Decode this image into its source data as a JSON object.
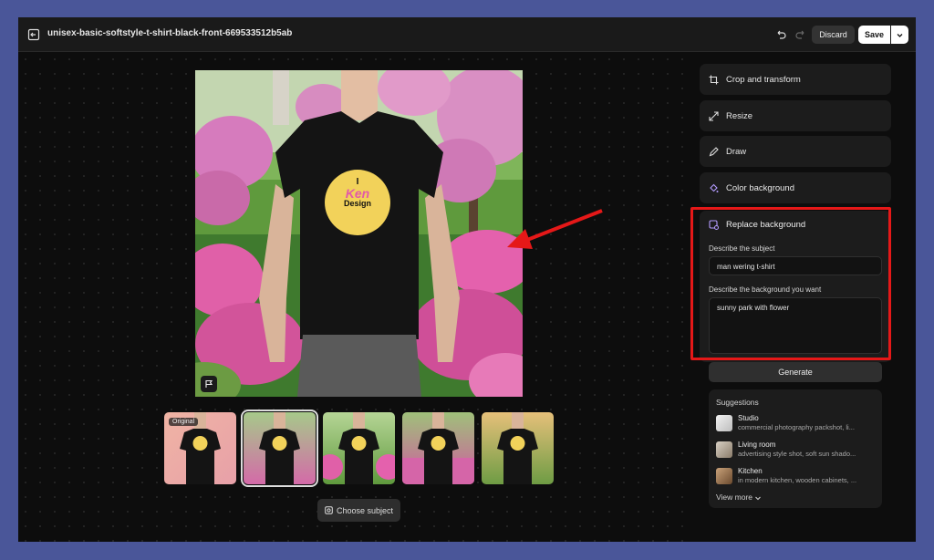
{
  "topbar": {
    "file_title": "unisex-basic-softstyle-t-shirt-black-front-669533512b5ab",
    "discard_label": "Discard",
    "save_label": "Save"
  },
  "canvas": {
    "thumbnails": [
      {
        "label": "Original",
        "selected": false
      },
      {
        "label": "",
        "selected": true
      },
      {
        "label": "",
        "selected": false
      },
      {
        "label": "",
        "selected": false
      },
      {
        "label": "",
        "selected": false
      }
    ],
    "choose_subject_label": "Choose subject",
    "tshirt_print": {
      "line1": "I",
      "line2": "Ken",
      "line3": "Design"
    }
  },
  "panel": {
    "items": [
      {
        "label": "Crop and transform",
        "icon": "crop-icon"
      },
      {
        "label": "Resize",
        "icon": "resize-icon"
      },
      {
        "label": "Draw",
        "icon": "draw-icon"
      },
      {
        "label": "Color background",
        "icon": "color-background-icon"
      }
    ],
    "replace_background": {
      "title": "Replace background",
      "subject_label": "Describe the subject",
      "subject_value": "man wering t-shirt",
      "background_label": "Describe the background you want",
      "background_value": "sunny park with flower"
    },
    "generate_label": "Generate",
    "suggestions": {
      "title": "Suggestions",
      "items": [
        {
          "name": "Studio",
          "desc": "commercial photography packshot, li..."
        },
        {
          "name": "Living room",
          "desc": "advertising style shot, soft sun shado..."
        },
        {
          "name": "Kitchen",
          "desc": "in modern kitchen, wooden cabinets, ..."
        }
      ],
      "view_more": "View more"
    }
  },
  "colors": {
    "frame": "#4a5699",
    "app_bg": "#0d0d0d",
    "highlight": "#e51818"
  }
}
